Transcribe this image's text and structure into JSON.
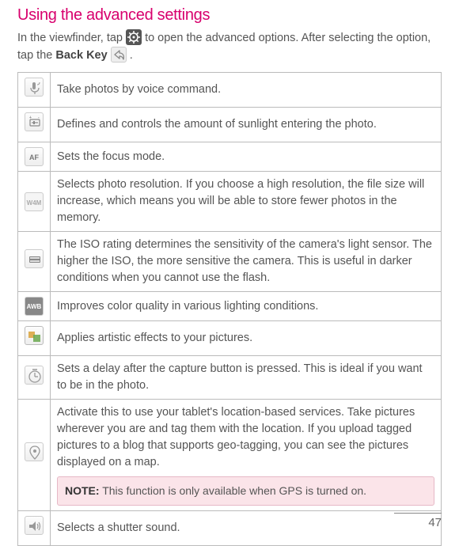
{
  "title": "Using the advanced settings",
  "intro_parts": {
    "p1": "In the viewfinder, tap ",
    "p2": " to open the advanced options. After selecting the option, tap the ",
    "back_key_bold": "Back Key",
    "p3": " ."
  },
  "rows": [
    {
      "icon": "voice-icon",
      "label": "",
      "desc": "Take photos by voice command."
    },
    {
      "icon": "brightness-icon",
      "label": "",
      "desc": "Defines and controls the amount of sunlight entering the photo."
    },
    {
      "icon": "focus-icon",
      "label": "AF",
      "desc": "Sets the focus mode."
    },
    {
      "icon": "resolution-icon",
      "label": "W4M",
      "desc": "Selects photo resolution. If you choose a high resolution, the file size will increase, which means you will be able to store fewer photos in the memory."
    },
    {
      "icon": "iso-icon",
      "label": "",
      "desc": "The ISO rating determines the sensitivity of the camera's light sensor. The higher the ISO, the more sensitive the camera. This is useful in darker conditions when you cannot use the flash."
    },
    {
      "icon": "awb-icon",
      "label": "AWB",
      "desc": "Improves color quality in various lighting conditions."
    },
    {
      "icon": "effects-icon",
      "label": "",
      "desc": "Applies artistic effects to your pictures."
    },
    {
      "icon": "timer-icon",
      "label": "",
      "desc": "Sets a delay after the capture button is pressed. This is ideal if you want to be in the photo."
    },
    {
      "icon": "geotag-icon",
      "label": "",
      "desc": "Activate this to use your tablet's location-based services. Take pictures wherever you are and tag them with the location. If you upload tagged pictures to a blog that supports geo-tagging, you can see the pictures displayed on a map.",
      "note_bold": "NOTE:",
      "note_text": " This function is only available when GPS is turned on."
    },
    {
      "icon": "shutter-sound-icon",
      "label": "",
      "desc": "Selects a shutter sound."
    }
  ],
  "page_number": "47"
}
